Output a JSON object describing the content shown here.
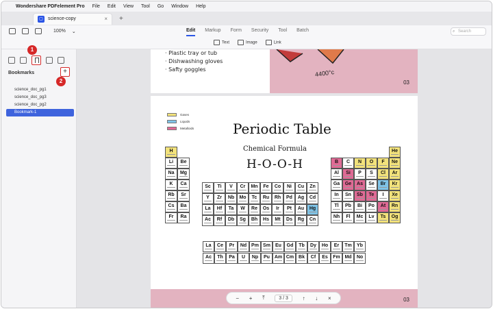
{
  "menubar": {
    "apple": "",
    "app_name": "Wondershare PDFelement Pro",
    "items": [
      "File",
      "Edit",
      "View",
      "Tool",
      "Go",
      "Window",
      "Help"
    ]
  },
  "tab": {
    "title": "science-copy",
    "close": "×",
    "new_tab": "+"
  },
  "toolbar": {
    "zoom": "100%",
    "modes": [
      "Edit",
      "Markup",
      "Form",
      "Security",
      "Tool",
      "Batch"
    ],
    "active_mode": "Edit",
    "search_placeholder": "Search"
  },
  "subtoolbar": {
    "text": "Text",
    "image": "Image",
    "link": "Link"
  },
  "sidebar": {
    "title": "Bookmarks",
    "add": "+",
    "bookmarks": [
      "science_doc_pg1",
      "science_doc_pg3",
      "science_doc_pg2",
      "Bookmark-1"
    ],
    "selected": "Bookmark-1",
    "badges": [
      "1",
      "2"
    ]
  },
  "page1": {
    "bullets": [
      "· Plastic tray or tub",
      "· Dishwashing gloves",
      "· Safty goggles"
    ],
    "temperature": "4400°c",
    "page_number": "03"
  },
  "page2": {
    "legend": [
      {
        "label": "Gases",
        "color": "#f2e27b"
      },
      {
        "label": "Liquids",
        "color": "#7fc4e8"
      },
      {
        "label": "Metalloids",
        "color": "#e06a95"
      }
    ],
    "title": "Periodic Table",
    "subtitle": "Chemical Formula",
    "formula": "H-O-O-H",
    "page_number": "03",
    "left_block": [
      [
        "H",
        ""
      ],
      [
        "Li",
        "Be"
      ],
      [
        "Na",
        "Mg"
      ],
      [
        "K",
        "Ca"
      ],
      [
        "Rb",
        "Sr"
      ],
      [
        "Cs",
        "Ba"
      ],
      [
        "Fr",
        "Ra"
      ]
    ],
    "transition_block": [
      [
        "Sc",
        "Ti",
        "V",
        "Cr",
        "Mn",
        "Fe",
        "Co",
        "Ni",
        "Cu",
        "Zn"
      ],
      [
        "Y",
        "Zr",
        "Nb",
        "Mo",
        "Tc",
        "Ru",
        "Rh",
        "Pd",
        "Ag",
        "Cd"
      ],
      [
        "La",
        "Hf",
        "Ta",
        "W",
        "Re",
        "Os",
        "Ir",
        "Pt",
        "Au",
        "Hg"
      ],
      [
        "Ac",
        "Rf",
        "Db",
        "Sg",
        "Bh",
        "Hs",
        "Mt",
        "Ds",
        "Rg",
        "Cn"
      ]
    ],
    "right_block": [
      [
        "",
        "",
        "",
        "",
        "",
        "He"
      ],
      [
        "B",
        "C",
        "N",
        "O",
        "F",
        "Ne"
      ],
      [
        "Al",
        "Si",
        "P",
        "S",
        "Cl",
        "Ar"
      ],
      [
        "Ga",
        "Ge",
        "As",
        "Se",
        "Br",
        "Kr"
      ],
      [
        "In",
        "Sn",
        "Sb",
        "Te",
        "I",
        "Xe"
      ],
      [
        "Tl",
        "Pb",
        "Bi",
        "Po",
        "At",
        "Rn"
      ],
      [
        "Nh",
        "Fl",
        "Mc",
        "Lv",
        "Ts",
        "Og"
      ]
    ],
    "lanthanides": [
      "La",
      "Ce",
      "Pr",
      "Nd",
      "Pm",
      "Sm",
      "Eu",
      "Gd",
      "Tb",
      "Dy",
      "Ho",
      "Er",
      "Tm",
      "Yb"
    ],
    "actinides": [
      "Ac",
      "Th",
      "Pa",
      "U",
      "Np",
      "Pu",
      "Am",
      "Cm",
      "Bk",
      "Cf",
      "Es",
      "Fm",
      "Md",
      "No"
    ]
  },
  "colors": {
    "gas": "#f2e27b",
    "liquid": "#7fc4e8",
    "metalloid": "#e06a95",
    "accent": "#3e63dd",
    "highlight": "#d62828"
  },
  "page_controls": {
    "zoom_out": "−",
    "zoom_in": "+",
    "first": "⤒",
    "page": "3 / 3",
    "up": "↑",
    "down": "↓",
    "close": "×"
  }
}
